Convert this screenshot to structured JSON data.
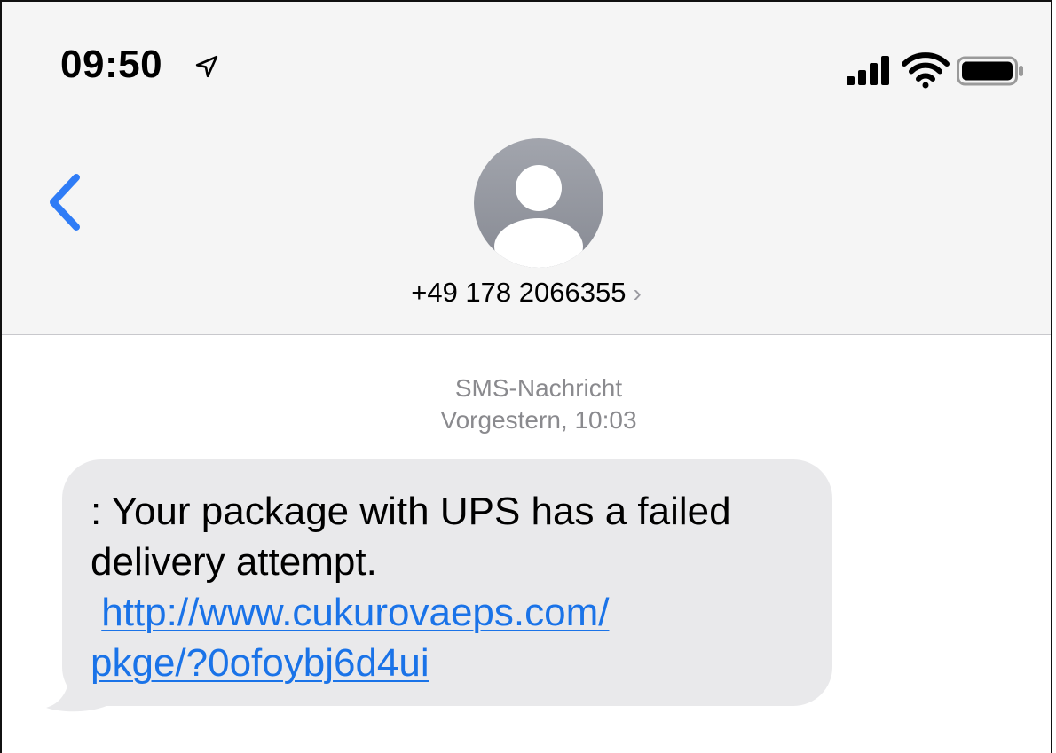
{
  "status_bar": {
    "time": "09:50",
    "location_icon": "location-arrow-icon",
    "signal_icon": "cellular-signal-icon",
    "wifi_icon": "wifi-icon",
    "battery_icon": "battery-icon"
  },
  "header": {
    "back_icon": "chevron-left-icon",
    "avatar_icon": "person-placeholder-icon",
    "contact_number": "+49 178 2066355",
    "contact_chevron": "›"
  },
  "conversation": {
    "message_type": "SMS-Nachricht",
    "timestamp": "Vorgestern, 10:03",
    "messages": [
      {
        "text": ": Your package with UPS has a failed delivery attempt.",
        "link_line1": "http://www.cukurovaeps.com/",
        "link_line2": "pkge/?0ofoybj6d4ui"
      }
    ]
  },
  "colors": {
    "accent": "#1a73e8",
    "back_chevron": "#2f7cf6",
    "bubble_bg": "#e9e9eb",
    "header_bg": "#f5f5f5",
    "meta_text": "#8a8a8e"
  }
}
